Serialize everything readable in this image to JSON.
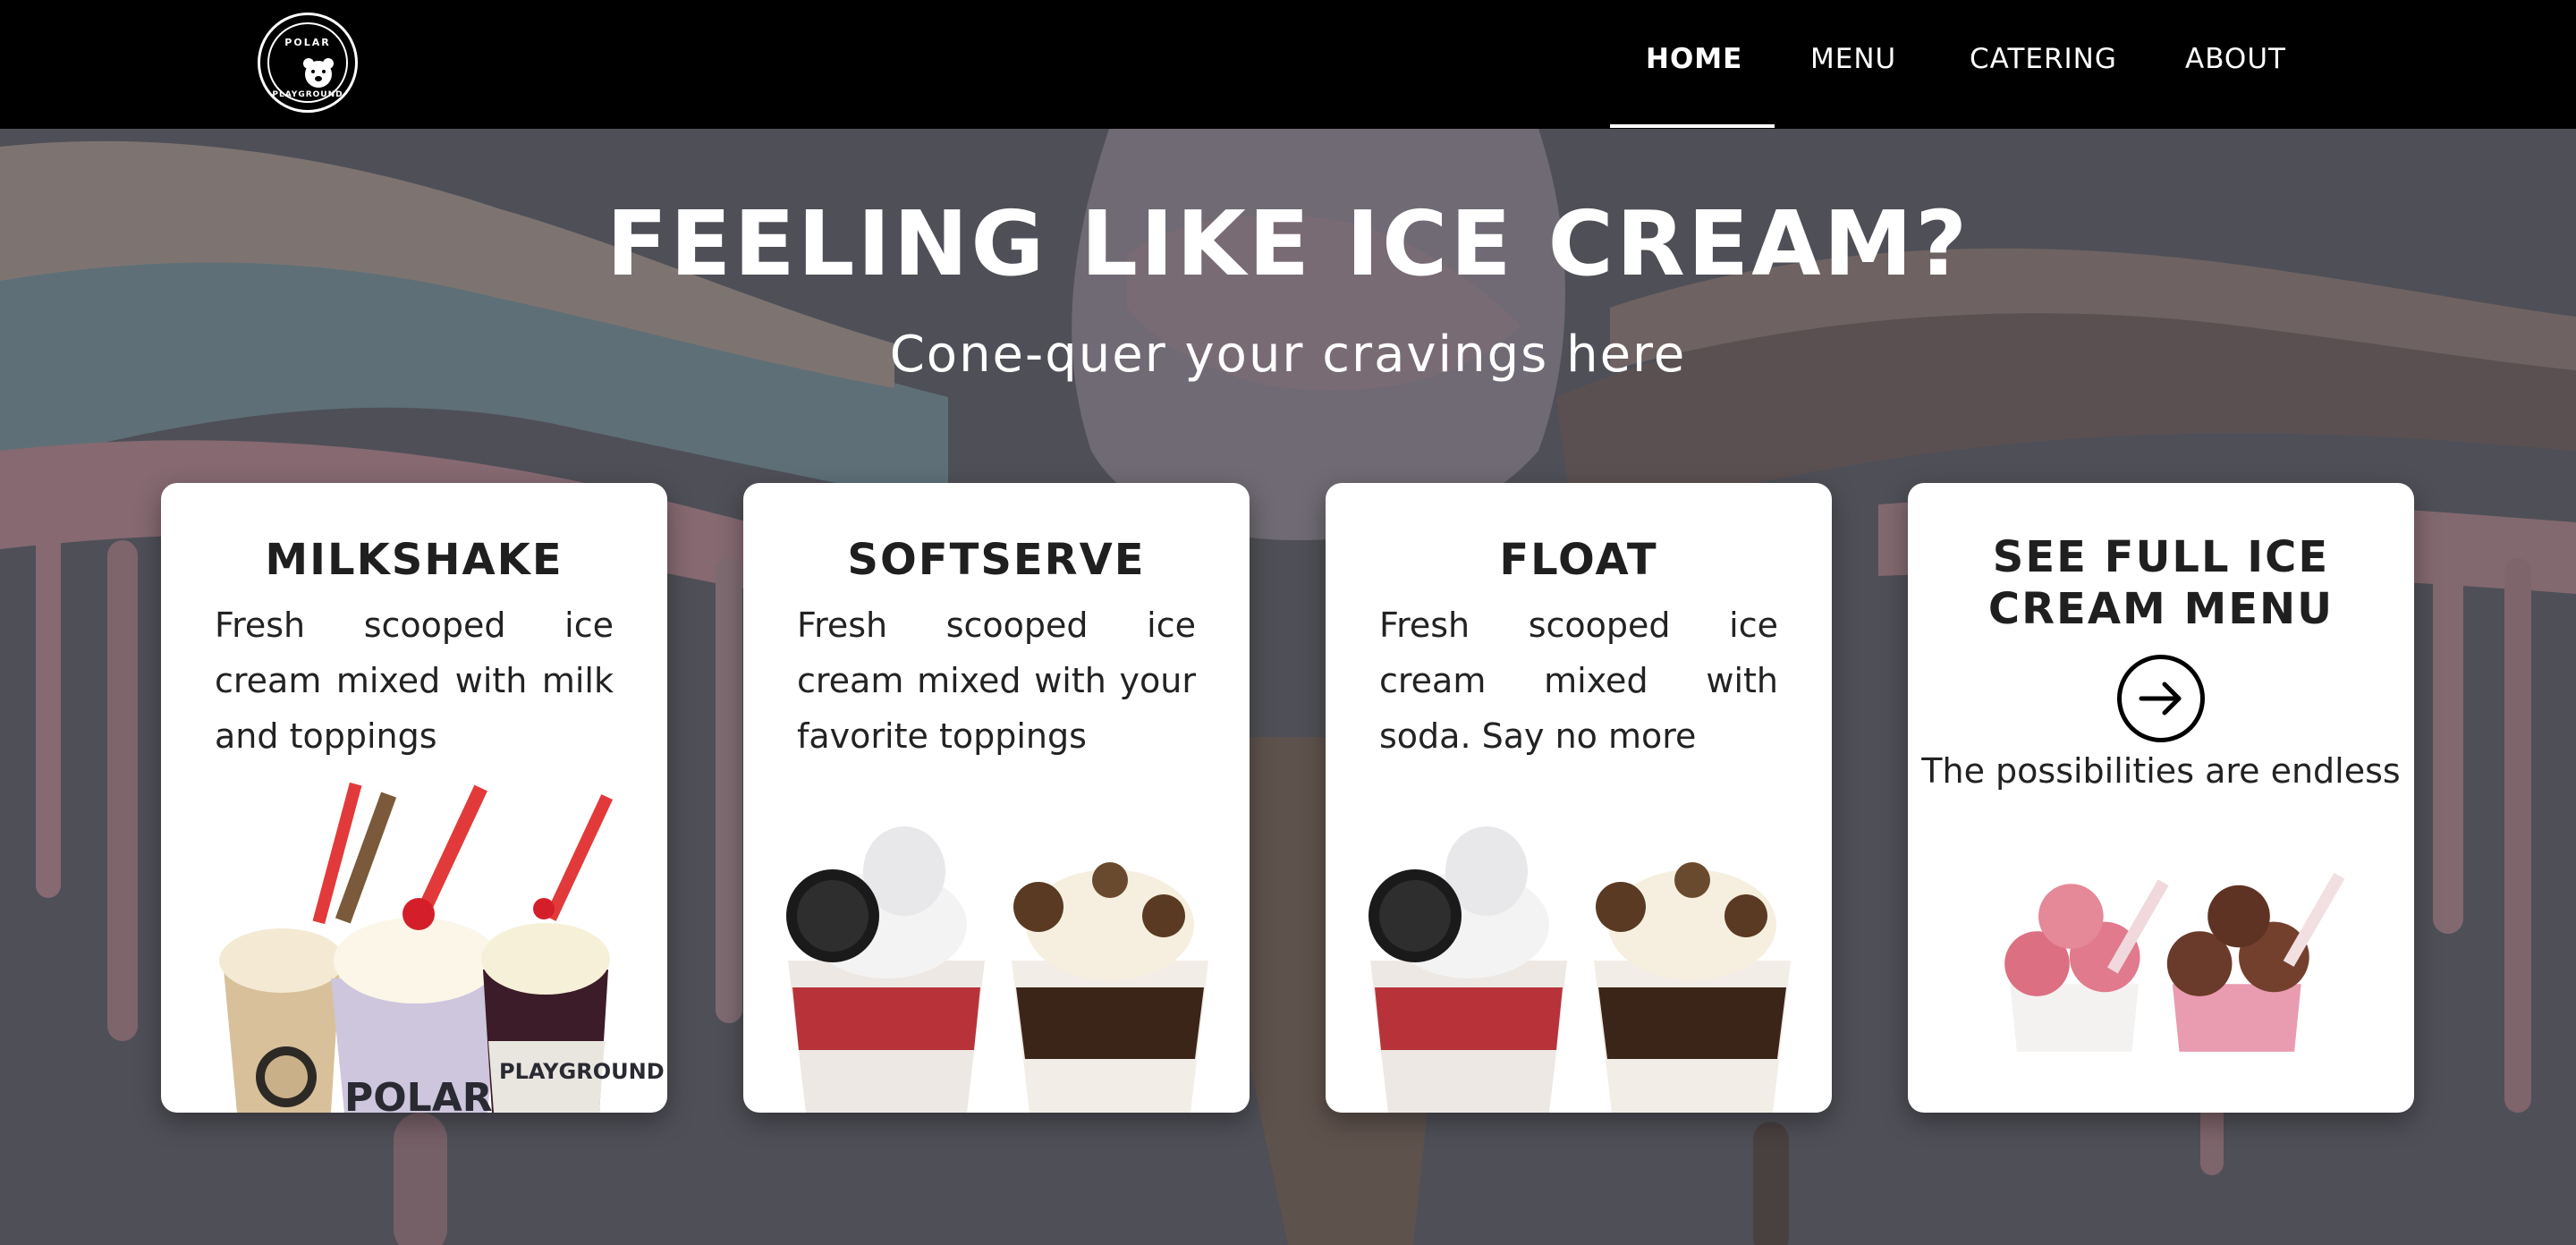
{
  "nav": {
    "logo_text_top": "POLAR",
    "logo_text_bottom": "PLAYGROUND",
    "links": [
      {
        "label": "HOME",
        "active": true
      },
      {
        "label": "MENU",
        "active": false
      },
      {
        "label": "CATERING",
        "active": false
      },
      {
        "label": "ABOUT",
        "active": false
      }
    ]
  },
  "hero": {
    "title": "FEELING LIKE ICE CREAM?",
    "subtitle": "Cone-quer your cravings here"
  },
  "cards": [
    {
      "title": "MILKSHAKE",
      "description": "Fresh scooped ice cream mixed with milk and toppings",
      "cup_label_1": "POLAR",
      "cup_label_2": "PLAYGROUND"
    },
    {
      "title": "SOFTSERVE",
      "description": "Fresh scooped ice cream mixed with your favorite toppings"
    },
    {
      "title": "FLOAT",
      "description": "Fresh scooped ice cream mixed with soda. Say no more"
    },
    {
      "title": "SEE FULL ICE CREAM MENU",
      "description": "The possibilities are endless"
    }
  ],
  "colors": {
    "nav_bg": "#000000",
    "accent": "#ffffff",
    "card_bg": "#ffffff",
    "hero_overlay": "#56565c"
  }
}
